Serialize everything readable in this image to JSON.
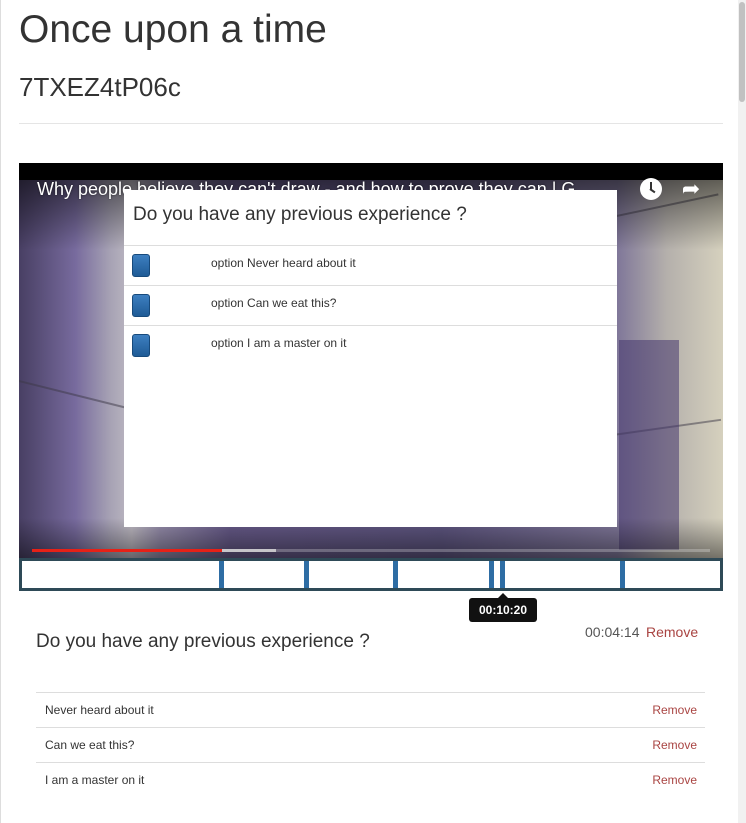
{
  "page": {
    "title": "Once upon a time",
    "subtitle": "7TXEZ4tP06c"
  },
  "video": {
    "title": "Why people believe they can't draw - and how to prove they can | G..",
    "progress_played_fraction": 0.28,
    "progress_buffered_fraction": 0.36
  },
  "overlay": {
    "question": "Do you have any previous experience ?",
    "options": [
      {
        "label": "option Never heard about it"
      },
      {
        "label": "option Can we eat this?"
      },
      {
        "label": "option I am a master on it"
      }
    ]
  },
  "timeline": {
    "tooltip": "00:10:20"
  },
  "question": {
    "text": "Do you have any previous experience ?",
    "time": "00:04:14",
    "remove_label": "Remove",
    "answers": [
      {
        "text": "Never heard about it",
        "remove_label": "Remove"
      },
      {
        "text": "Can we eat this?",
        "remove_label": "Remove"
      },
      {
        "text": "I am a master on it",
        "remove_label": "Remove"
      }
    ]
  },
  "colors": {
    "accent": "#2e6da4",
    "remove": "#a94442",
    "progress": "#e62117"
  }
}
